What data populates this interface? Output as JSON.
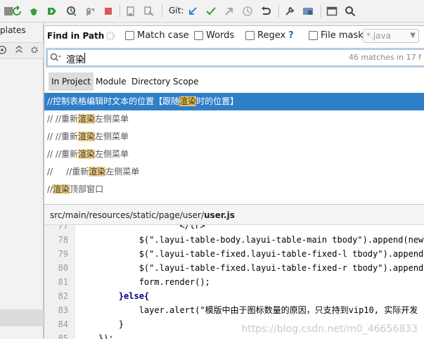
{
  "toolbar": {
    "git_label": "Git:",
    "icons": [
      "rerun-icon",
      "debug-icon",
      "coverage-icon",
      "profile-icon",
      "attach-icon",
      "stop-icon",
      "build-icon",
      "deploy-icon",
      "git-update-icon",
      "git-commit-icon",
      "git-push-icon",
      "history-icon",
      "rollback-icon",
      "settings-icon",
      "project-structure-icon",
      "terminal-icon",
      "search-icon"
    ]
  },
  "left_panel": {
    "tab_label": "plates"
  },
  "find_in_path": {
    "title": "Find in Path",
    "options": {
      "match_case": "Match case",
      "words": "Words",
      "regex": "Regex",
      "regex_help": "?",
      "file_mask": "File mask:",
      "file_mask_value": "*.java"
    },
    "search": {
      "query": "渲染",
      "match_count": "46 matches in 17 f"
    },
    "scopes": [
      {
        "label": "In Project",
        "active": true
      },
      {
        "label": "Module",
        "active": false
      },
      {
        "label": "Directory",
        "active": false
      },
      {
        "label": "Scope",
        "active": false
      }
    ],
    "results": [
      {
        "before": "//控制表格编辑时文本的位置【跟随",
        "match": "渲染",
        "after": "时的位置】",
        "selected": true
      },
      {
        "before": "// //重新",
        "match": "渲染",
        "after": "左侧菜单",
        "selected": false
      },
      {
        "before": "// //重新",
        "match": "渲染",
        "after": "左侧菜单",
        "selected": false
      },
      {
        "before": "// //重新",
        "match": "渲染",
        "after": "左侧菜单",
        "selected": false
      },
      {
        "before": "//     //重新",
        "match": "渲染",
        "after": "左侧菜单",
        "selected": false
      },
      {
        "before": "//",
        "match": "渲染",
        "after": "顶部窗口",
        "selected": false
      }
    ],
    "preview": {
      "path_prefix": "src/main/resources/static/page/user/",
      "file_name": "user.js",
      "lines": [
        {
          "n": "77",
          "text": "                    </tr>\"'"
        },
        {
          "n": "78",
          "text": "            $(\".layui-table-body.layui-table-main tbody\").append(newHtm"
        },
        {
          "n": "79",
          "text": "            $(\".layui-table-fixed.layui-table-fixed-l tbody\").append('<"
        },
        {
          "n": "80",
          "text": "            $(\".layui-table-fixed.layui-table-fixed-r tbody\").append('<"
        },
        {
          "n": "81",
          "text": "            form.render();"
        },
        {
          "n": "82",
          "text": "        }else{"
        },
        {
          "n": "83",
          "text": "            layer.alert(\"模版中由于图标数量的原因，只支持到vip10, 实际开发"
        },
        {
          "n": "84",
          "text": "        }"
        },
        {
          "n": "85",
          "text": "    });"
        }
      ]
    }
  },
  "watermark": "https://blog.csdn.net/m0_46656833"
}
